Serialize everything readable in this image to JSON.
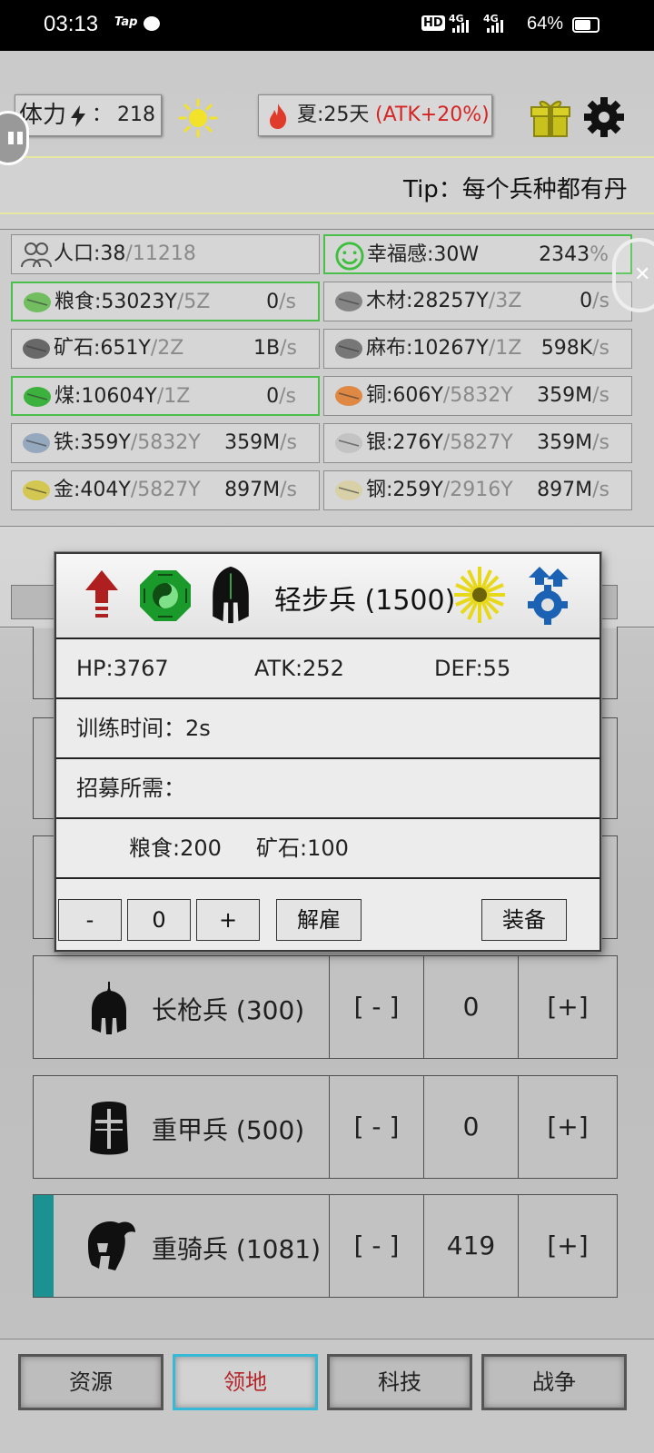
{
  "status_bar": {
    "time": "03:13",
    "app_badge": "Tap",
    "hd_badge": "HD",
    "network_1": "4G",
    "network_2": "4G",
    "battery": "64%"
  },
  "top": {
    "stamina_label": "体力",
    "stamina_sep": "：",
    "stamina_value": "218",
    "season_label": "夏:25天",
    "season_bonus": "(ATK+20%)"
  },
  "tip": "Tip：每个兵种都有丹",
  "resources": [
    {
      "name": "人口:38",
      "cap": "/11218",
      "rate": "",
      "rate_unit": "",
      "icon": "people-icon",
      "highlight": false
    },
    {
      "name": "幸福感:30W",
      "cap": "",
      "rate": "2343",
      "rate_unit": "%",
      "icon": "smiley-icon",
      "highlight": true
    },
    {
      "name": "粮食:53023Y",
      "cap": "/5Z",
      "rate": "0",
      "rate_unit": "/s",
      "icon": "grain-icon",
      "highlight": true
    },
    {
      "name": "木材:28257Y",
      "cap": "/3Z",
      "rate": "0",
      "rate_unit": "/s",
      "icon": "wood-icon",
      "highlight": false
    },
    {
      "name": "矿石:651Y",
      "cap": "/2Z",
      "rate": "1B",
      "rate_unit": "/s",
      "icon": "ore-icon",
      "highlight": false
    },
    {
      "name": "麻布:10267Y",
      "cap": "/1Z",
      "rate": "598K",
      "rate_unit": "/s",
      "icon": "linen-icon",
      "highlight": false
    },
    {
      "name": "煤:10604Y",
      "cap": "/1Z",
      "rate": "0",
      "rate_unit": "/s",
      "icon": "coal-icon",
      "highlight": true
    },
    {
      "name": "铜:606Y",
      "cap": "/5832Y",
      "rate": "359M",
      "rate_unit": "/s",
      "icon": "copper-icon",
      "highlight": false
    },
    {
      "name": "铁:359Y",
      "cap": "/5832Y",
      "rate": "359M",
      "rate_unit": "/s",
      "icon": "iron-icon",
      "highlight": false
    },
    {
      "name": "银:276Y",
      "cap": "/5827Y",
      "rate": "359M",
      "rate_unit": "/s",
      "icon": "silver-icon",
      "highlight": false
    },
    {
      "name": "金:404Y",
      "cap": "/5827Y",
      "rate": "897M",
      "rate_unit": "/s",
      "icon": "gold-icon",
      "highlight": false
    },
    {
      "name": "钢:259Y",
      "cap": "/2916Y",
      "rate": "897M",
      "rate_unit": "/s",
      "icon": "steel-icon",
      "highlight": false
    }
  ],
  "units": [
    {
      "name": "长枪兵 (300)",
      "minus": "[ - ]",
      "count": "0",
      "plus": "[+]"
    },
    {
      "name": "重甲兵 (500)",
      "minus": "[ - ]",
      "count": "0",
      "plus": "[+]"
    },
    {
      "name": "重骑兵 (1081)",
      "minus": "[ - ]",
      "count": "419",
      "plus": "[+]"
    }
  ],
  "modal": {
    "title": "轻步兵 (1500)",
    "hp": "HP:3767",
    "atk": "ATK:252",
    "def": "DEF:55",
    "train_time": "训练时间：2s",
    "recruit_label": "招募所需：",
    "cost_food": "粮食:200",
    "cost_ore": "矿石:100",
    "minus": "-",
    "qty": "0",
    "plus": "+",
    "dismiss": "解雇",
    "equip": "装备"
  },
  "nav": [
    {
      "label": "资源",
      "active": false
    },
    {
      "label": "领地",
      "active": true
    },
    {
      "label": "科技",
      "active": false
    },
    {
      "label": "战争",
      "active": false
    }
  ],
  "colors": {
    "accent_teal": "#1e9b9b",
    "nav_active_border": "#35b9d6",
    "nav_active_text": "#b3262b",
    "highlight_green": "#4bbf4b",
    "bonus_red": "#d62424"
  }
}
